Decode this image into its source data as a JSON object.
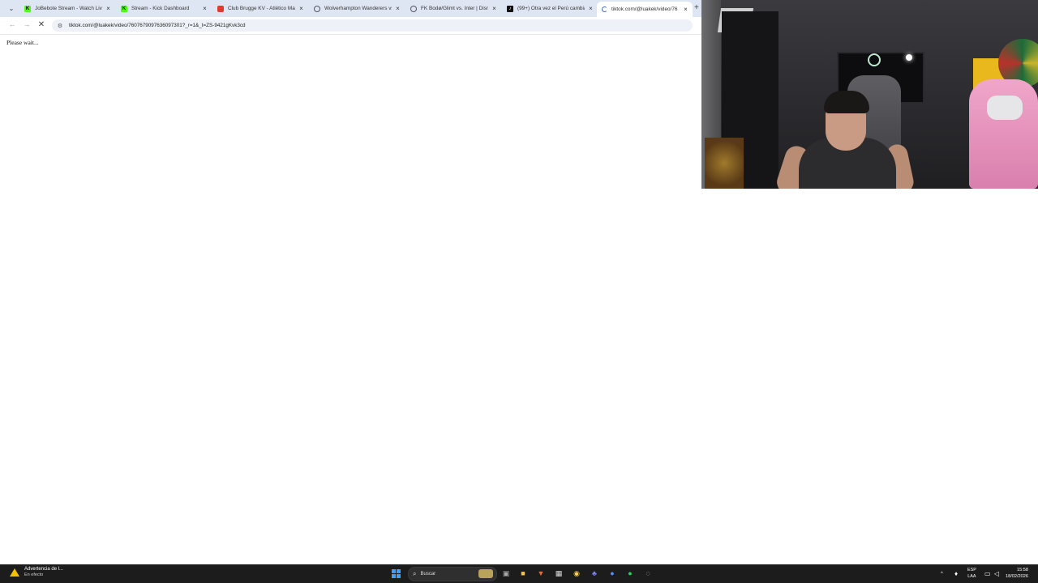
{
  "browser": {
    "tabs": [
      {
        "title": "JoBebote Stream - Watch Live",
        "favicon": "kick-icon",
        "active": false
      },
      {
        "title": "Stream - Kick Dashboard",
        "favicon": "kick-icon",
        "active": false
      },
      {
        "title": "Club Brugge KV - Atlético Mad",
        "favicon": "red-icon",
        "active": false
      },
      {
        "title": "Wolverhampton Wanderers vs",
        "favicon": "globe-icon",
        "active": false
      },
      {
        "title": "FK Bodø/Glimt vs. Inter | Disnc",
        "favicon": "globe-icon",
        "active": false
      },
      {
        "title": "(99+) Otra vez el Perú cambia d",
        "favicon": "tiktok-icon",
        "active": false
      },
      {
        "title": "tiktok.com/@luakek/video/76",
        "favicon": "loading-icon",
        "active": true
      }
    ],
    "url": "tiktok.com/@luakek/video/7607679097636097301?_r=1&_t=ZS-9421gKvk3cd"
  },
  "page": {
    "message": "Please wait..."
  },
  "taskbar": {
    "notification_title": "Advertencia de l...",
    "notification_sub": "En efecto",
    "search_placeholder": "Buscar",
    "lang_top": "ESP",
    "lang_bottom": "LAA",
    "time": "15:58",
    "date": "18/02/2026"
  },
  "colors": {
    "tabbar_bg": "#dfe6f3",
    "taskbar_bg": "#1c1c1c",
    "kick_green": "#53fc18"
  }
}
